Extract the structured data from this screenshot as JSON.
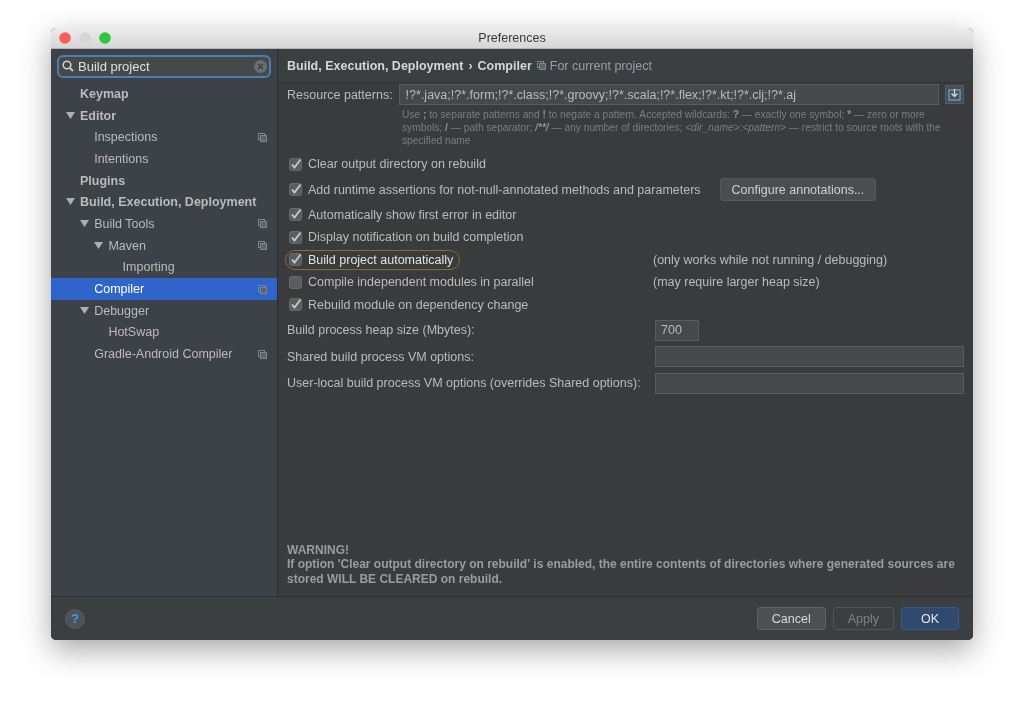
{
  "window": {
    "title": "Preferences"
  },
  "search": {
    "value": "Build project"
  },
  "sidebar": {
    "items": [
      {
        "label": "Keymap",
        "selected": false,
        "project_level": false
      },
      {
        "label": "Editor",
        "expanded": true,
        "selected": false,
        "project_level": false,
        "children": [
          {
            "label": "Inspections",
            "selected": false,
            "project_level": true
          },
          {
            "label": "Intentions",
            "selected": false,
            "project_level": false
          }
        ]
      },
      {
        "label": "Plugins",
        "selected": false,
        "project_level": false
      },
      {
        "label": "Build, Execution, Deployment",
        "expanded": true,
        "selected": false,
        "project_level": false,
        "children": [
          {
            "label": "Build Tools",
            "expanded": true,
            "selected": false,
            "project_level": true,
            "children": [
              {
                "label": "Maven",
                "expanded": true,
                "selected": false,
                "project_level": true,
                "children": [
                  {
                    "label": "Importing",
                    "selected": false,
                    "project_level": false
                  }
                ]
              }
            ]
          },
          {
            "label": "Compiler",
            "selected": true,
            "project_level": true
          },
          {
            "label": "Debugger",
            "expanded": true,
            "selected": false,
            "project_level": false,
            "children": [
              {
                "label": "HotSwap",
                "selected": false,
                "project_level": false
              }
            ]
          },
          {
            "label": "Gradle-Android Compiler",
            "selected": false,
            "project_level": true
          }
        ]
      }
    ]
  },
  "breadcrumb": {
    "parent": "Build, Execution, Deployment",
    "separator": "›",
    "current": "Compiler",
    "scope": "For current project"
  },
  "resource_patterns": {
    "label": "Resource patterns:",
    "value": "!?*.java;!?*.form;!?*.class;!?*.groovy;!?*.scala;!?*.flex;!?*.kt;!?*.clj;!?*.aj",
    "hint": [
      {
        "text": "Use ",
        "kind": "plain"
      },
      {
        "text": ";",
        "kind": "symbol"
      },
      {
        "text": " to separate patterns and ",
        "kind": "plain"
      },
      {
        "text": "!",
        "kind": "symbol"
      },
      {
        "text": " to negate a pattern. Accepted wildcards: ",
        "kind": "plain"
      },
      {
        "text": "?",
        "kind": "symbol"
      },
      {
        "text": " — exactly one symbol; ",
        "kind": "plain"
      },
      {
        "text": "*",
        "kind": "symbol"
      },
      {
        "text": " — zero or more symbols; ",
        "kind": "plain"
      },
      {
        "text": "/",
        "kind": "symbol"
      },
      {
        "text": " — path separator; ",
        "kind": "plain"
      },
      {
        "text": "/**/",
        "kind": "pattern"
      },
      {
        "text": " — any number of directories; ",
        "kind": "plain"
      },
      {
        "text": "<dir_name>",
        "kind": "placeholder"
      },
      {
        "text": ":",
        "kind": "plain"
      },
      {
        "text": "<pattern>",
        "kind": "placeholder"
      },
      {
        "text": " — restrict to source roots with the specified name",
        "kind": "plain"
      }
    ]
  },
  "options": [
    {
      "label": "Clear output directory on rebuild",
      "checked": true,
      "highlighted": false
    },
    {
      "label": "Add runtime assertions for not-null-annotated methods and parameters",
      "checked": true,
      "highlighted": false,
      "button": "Configure annotations..."
    },
    {
      "label": "Automatically show first error in editor",
      "checked": true,
      "highlighted": false
    },
    {
      "label": "Display notification on build completion",
      "checked": true,
      "highlighted": false
    },
    {
      "label": "Build project automatically",
      "checked": true,
      "highlighted": true,
      "note": "(only works while not running / debugging)"
    },
    {
      "label": "Compile independent modules in parallel",
      "checked": false,
      "highlighted": false,
      "note": "(may require larger heap size)"
    },
    {
      "label": "Rebuild module on dependency change",
      "checked": true,
      "highlighted": false
    }
  ],
  "fields": [
    {
      "label": "Build process heap size (Mbytes):",
      "value": "700",
      "kind": "short"
    },
    {
      "label": "Shared build process VM options:",
      "kind": "wide"
    },
    {
      "label": "User-local build process VM options (overrides Shared options):",
      "kind": "wide"
    }
  ],
  "warning": {
    "title": "WARNING!",
    "text": "If option 'Clear output directory on rebuild' is enabled, the entire contents of directories where generated sources are stored WILL BE CLEARED on rebuild."
  },
  "help_button": {
    "label": "?"
  },
  "buttons": [
    {
      "label": "Cancel",
      "kind": "normal"
    },
    {
      "label": "Apply",
      "kind": "disabled"
    },
    {
      "label": "OK",
      "kind": "default"
    }
  ]
}
